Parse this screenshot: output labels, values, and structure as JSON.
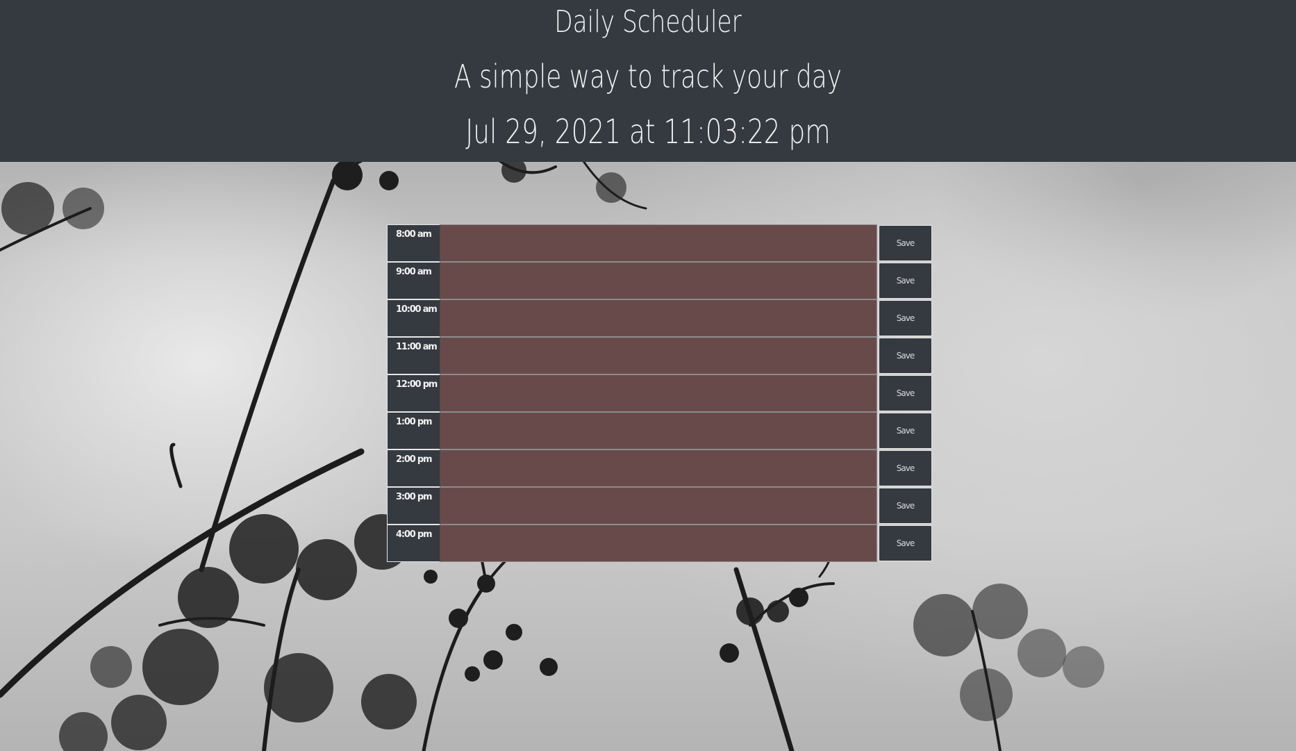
{
  "header": {
    "title": "Daily Scheduler",
    "subtitle": "A simple way to track your day",
    "datetime": "Jul 29, 2021 at 11:03:22 pm"
  },
  "colors": {
    "header_bg": "#353a41",
    "past_row": "#694a4a",
    "hour_bg": "#353a41"
  },
  "rows": [
    {
      "hour": "8:00 am",
      "text": "",
      "save_label": "Save"
    },
    {
      "hour": "9:00 am",
      "text": "",
      "save_label": "Save"
    },
    {
      "hour": "10:00 am",
      "text": "",
      "save_label": "Save"
    },
    {
      "hour": "11:00 am",
      "text": "",
      "save_label": "Save"
    },
    {
      "hour": "12:00 pm",
      "text": "",
      "save_label": "Save"
    },
    {
      "hour": "1:00 pm",
      "text": "",
      "save_label": "Save"
    },
    {
      "hour": "2:00 pm",
      "text": "",
      "save_label": "Save"
    },
    {
      "hour": "3:00 pm",
      "text": "",
      "save_label": "Save"
    },
    {
      "hour": "4:00 pm",
      "text": "",
      "save_label": "Save"
    }
  ]
}
